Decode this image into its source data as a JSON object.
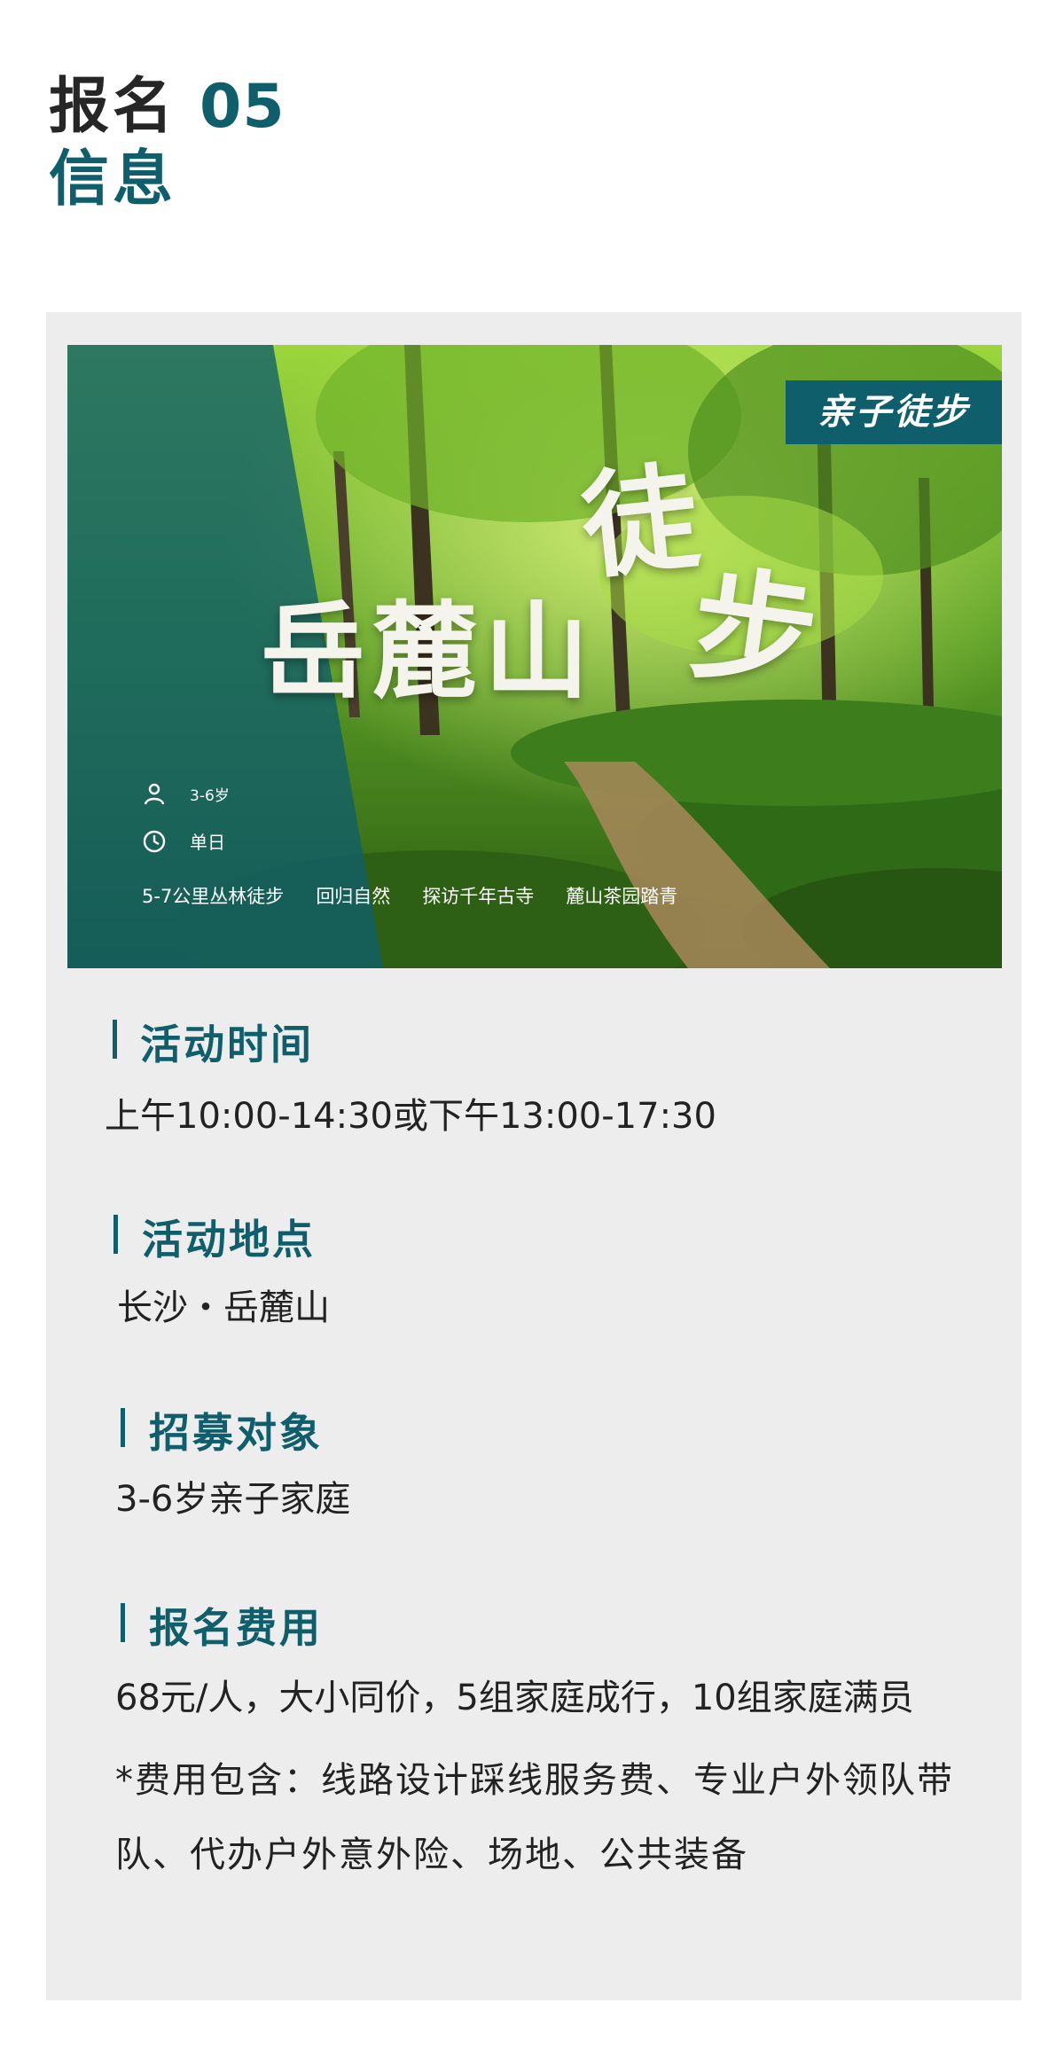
{
  "header": {
    "title_part1": "报名",
    "title_number": "05",
    "title_part2": "信息"
  },
  "hero": {
    "badge": "亲子徒步",
    "title_main": "岳麓山",
    "title_char1": "徒",
    "title_char2": "步",
    "age": "3-6岁",
    "age_icon": "person-icon",
    "duration": "单日",
    "duration_icon": "clock-icon",
    "tags": [
      "5-7公里丛林徒步",
      "回归自然",
      "探访千年古寺",
      "麓山茶园踏青"
    ],
    "colors": {
      "overlay": "#0f5e6c",
      "foliage_dark": "#2c5e14",
      "foliage_light": "#8cd033"
    }
  },
  "sections": [
    {
      "label": "活动时间",
      "value": "上午10:00-14:30或下午13:00-17:30"
    },
    {
      "label": "活动地点",
      "value": "长沙・岳麓山"
    },
    {
      "label": "招募对象",
      "value": "3-6岁亲子家庭"
    },
    {
      "label": "报名费用",
      "value": "68元/人，大小同价，5组家庭成行，10组家庭满员"
    }
  ],
  "fee_note": "*费用包含：线路设计踩线服务费、专业户外领队带队、代办户外意外险、场地、公共装备",
  "colors": {
    "accent": "#0f5e6c",
    "card_bg": "#ededed",
    "text": "#222222"
  }
}
